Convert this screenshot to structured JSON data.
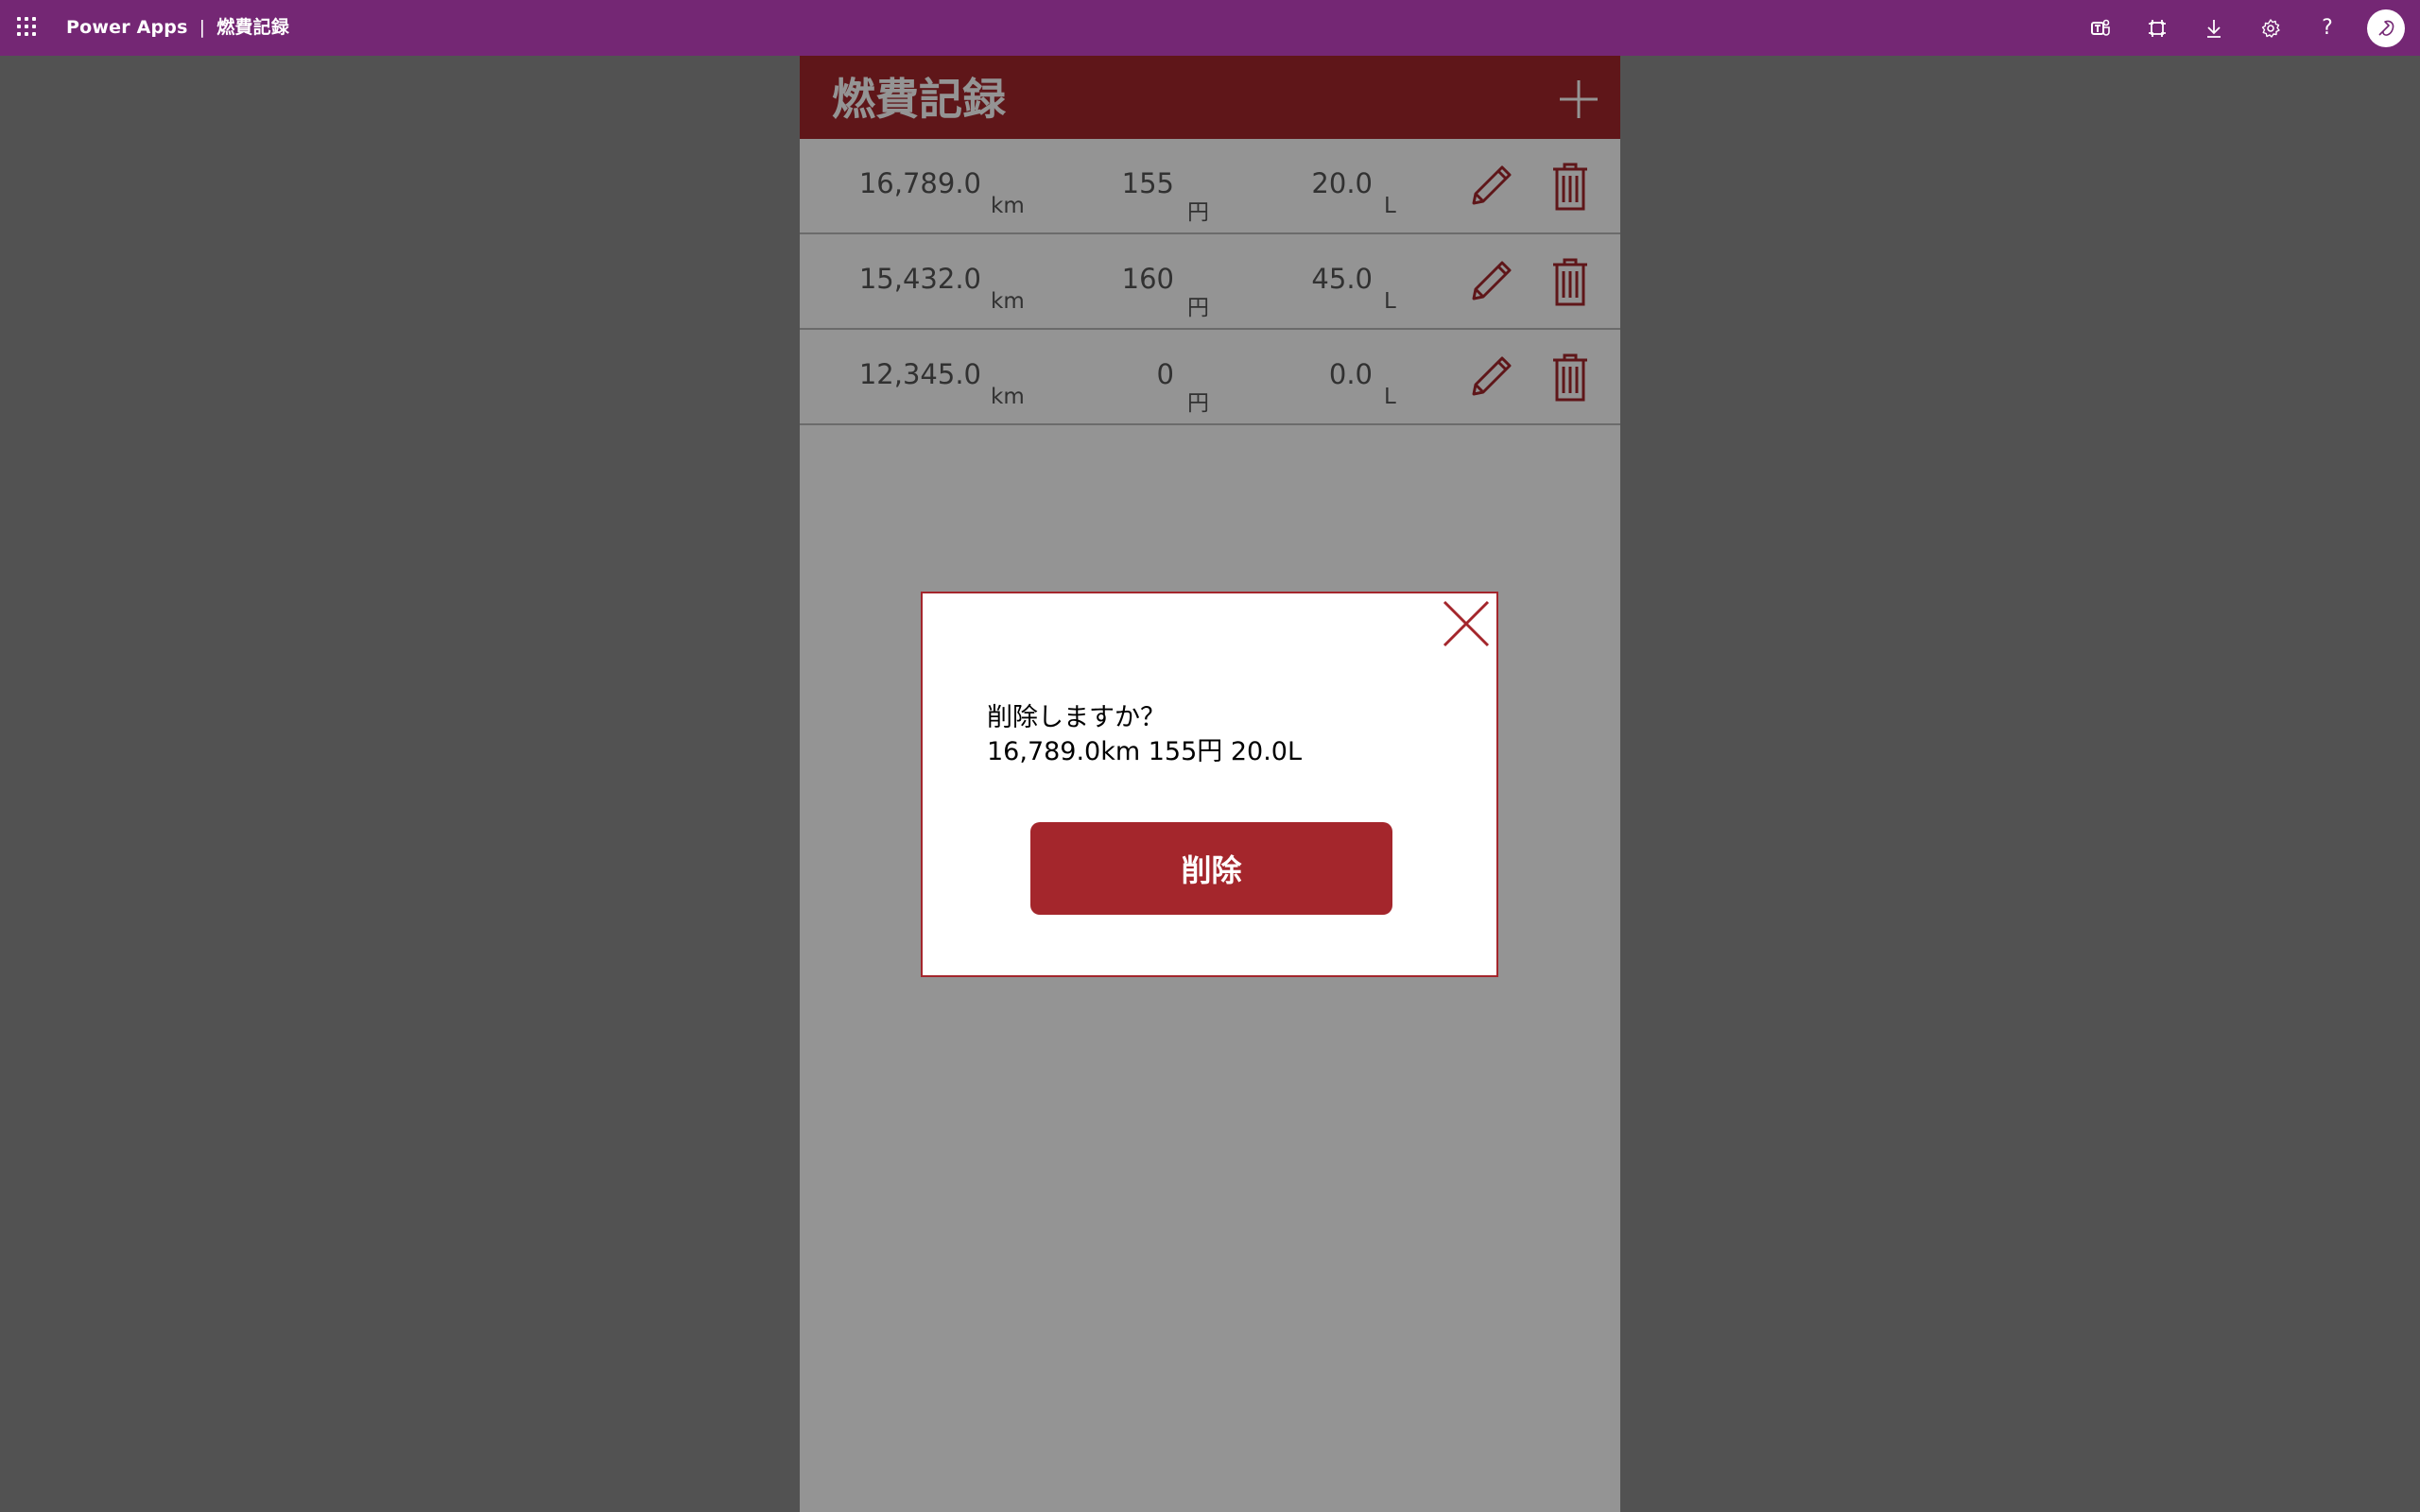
{
  "suitebar": {
    "product": "Power Apps",
    "separator": "|",
    "app_name": "燃費記録",
    "icons": [
      "teams-icon",
      "fit-to-screen-icon",
      "download-icon",
      "settings-icon",
      "help-icon",
      "avatar"
    ],
    "help_label": "?"
  },
  "app": {
    "title": "燃費記録",
    "add_icon": "plus-icon",
    "colors": {
      "accent": "#a4262c",
      "suitebar": "#742774"
    },
    "records": [
      {
        "odometer": "16,789.0",
        "odometer_unit": "km",
        "price": "155",
        "price_unit": "円",
        "liters": "20.0",
        "liters_unit": "L"
      },
      {
        "odometer": "15,432.0",
        "odometer_unit": "km",
        "price": "160",
        "price_unit": "円",
        "liters": "45.0",
        "liters_unit": "L"
      },
      {
        "odometer": "12,345.0",
        "odometer_unit": "km",
        "price": "0",
        "price_unit": "円",
        "liters": "0.0",
        "liters_unit": "L"
      }
    ]
  },
  "dialog": {
    "message_line1": "削除しますか？",
    "message_line2": "16,789.0km 155円 20.0L",
    "delete_button": "削除",
    "close_icon": "close-icon"
  }
}
